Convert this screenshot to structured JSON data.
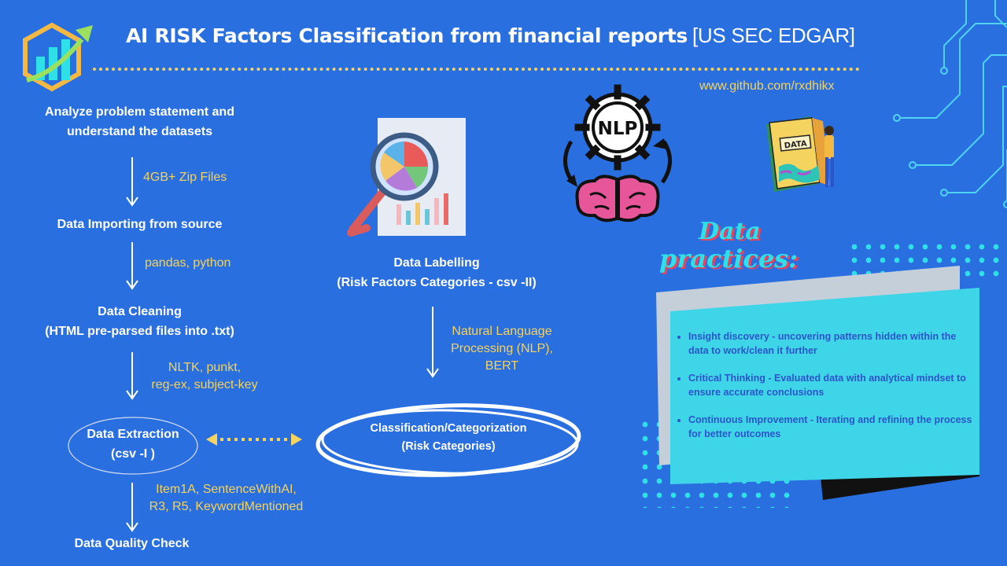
{
  "header": {
    "title": "AI RISK Factors Classification from financial reports",
    "subtitle": "[US SEC EDGAR]",
    "url": "www.github.com/rxdhikx"
  },
  "flow_left": {
    "step1": {
      "line1": "Analyze problem statement and",
      "line2": "understand the datasets"
    },
    "note1": "4GB+ Zip Files",
    "step2": "Data Importing from source",
    "note2": "pandas, python",
    "step3": {
      "line1": "Data Cleaning",
      "line2": "(HTML pre-parsed files into .txt)"
    },
    "note3": {
      "line1": "NLTK, punkt,",
      "line2": "reg-ex, subject-key"
    },
    "step4": {
      "line1": "Data Extraction",
      "line2": "(csv -I )"
    },
    "note4": {
      "line1": "Item1A, SentenceWithAI,",
      "line2": "R3, R5, KeywordMentioned"
    },
    "step5": "Data Quality Check"
  },
  "flow_middle": {
    "label": {
      "line1": "Data Labelling",
      "line2": "(Risk Factors Categories - csv -II)"
    },
    "note": {
      "line1": "Natural Language",
      "line2": "Processing (NLP),",
      "line3": "BERT"
    },
    "classification": {
      "line1": "Classification/Categorization",
      "line2": "(Risk Categories)"
    }
  },
  "icons": {
    "nlp_badge": "NLP",
    "data_book": "DATA"
  },
  "practices": {
    "title_line1": "Data",
    "title_line2": "practices:",
    "items": [
      "Insight discovery - uncovering patterns hidden within the data to work/clean it further",
      "Critical Thinking - Evaluated data with analytical mindset to ensure accurate conclusions",
      "Continuous Improvement - Iterating and refining the process for better outcomes"
    ]
  },
  "colors": {
    "background": "#2a6fe0",
    "accent_yellow": "#f4d35e",
    "card_cyan": "#3fd5e8",
    "card_text": "#2b55c9",
    "title_pink": "#e8435c"
  }
}
